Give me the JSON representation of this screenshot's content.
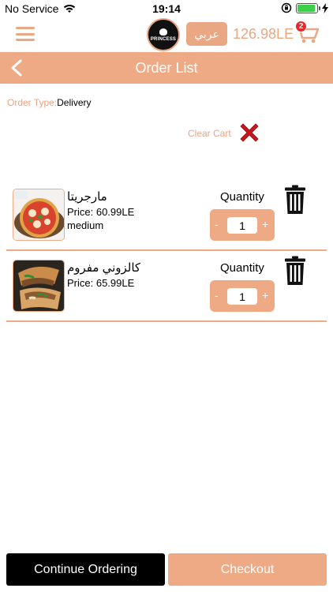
{
  "status_bar": {
    "carrier": "No Service",
    "time": "19:14",
    "battery_level": 0.9
  },
  "header": {
    "logo_text": "PRINCESS",
    "language_button": "عربي",
    "cart_total": "126.98LE",
    "cart_count": "2"
  },
  "title_bar": {
    "title": "Order List"
  },
  "order": {
    "type_label": "Order Type:",
    "type_value": "Delivery",
    "clear_cart": "Clear Cart"
  },
  "items": [
    {
      "name": "مارجريتا",
      "price": "Price: 60.99LE",
      "size": "medium",
      "quantity_label": "Quantity",
      "quantity": "1",
      "image": "pizza"
    },
    {
      "name": "كالزوني مفروم",
      "price": "Price: 65.99LE",
      "size": "",
      "quantity_label": "Quantity",
      "quantity": "1",
      "image": "calzone"
    }
  ],
  "buttons": {
    "continue": "Continue Ordering",
    "checkout": "Checkout"
  },
  "colors": {
    "accent": "#eeaa85",
    "danger": "#c8161d"
  }
}
